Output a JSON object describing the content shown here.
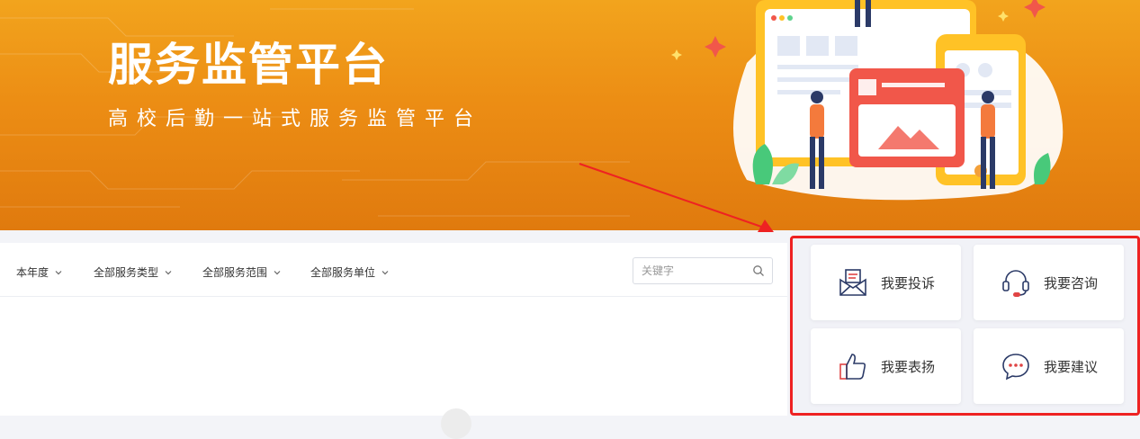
{
  "banner": {
    "title": "服务监管平台",
    "subtitle": "高校后勤一站式服务监管平台",
    "colors": {
      "gradient_top": "#f2a41d",
      "gradient_bottom": "#e07a0e",
      "accent_red": "#f1574a"
    }
  },
  "filters": {
    "items": [
      {
        "label": "本年度"
      },
      {
        "label": "全部服务类型"
      },
      {
        "label": "全部服务范围"
      },
      {
        "label": "全部服务单位"
      }
    ],
    "search": {
      "placeholder": "关键字",
      "value": ""
    }
  },
  "actions": {
    "highlight_color": "#ee2222",
    "items": [
      {
        "label": "我要投诉",
        "icon": "envelope-icon"
      },
      {
        "label": "我要咨询",
        "icon": "headset-icon"
      },
      {
        "label": "我要表扬",
        "icon": "thumbs-up-icon"
      },
      {
        "label": "我要建议",
        "icon": "chat-bubble-icon"
      }
    ]
  }
}
